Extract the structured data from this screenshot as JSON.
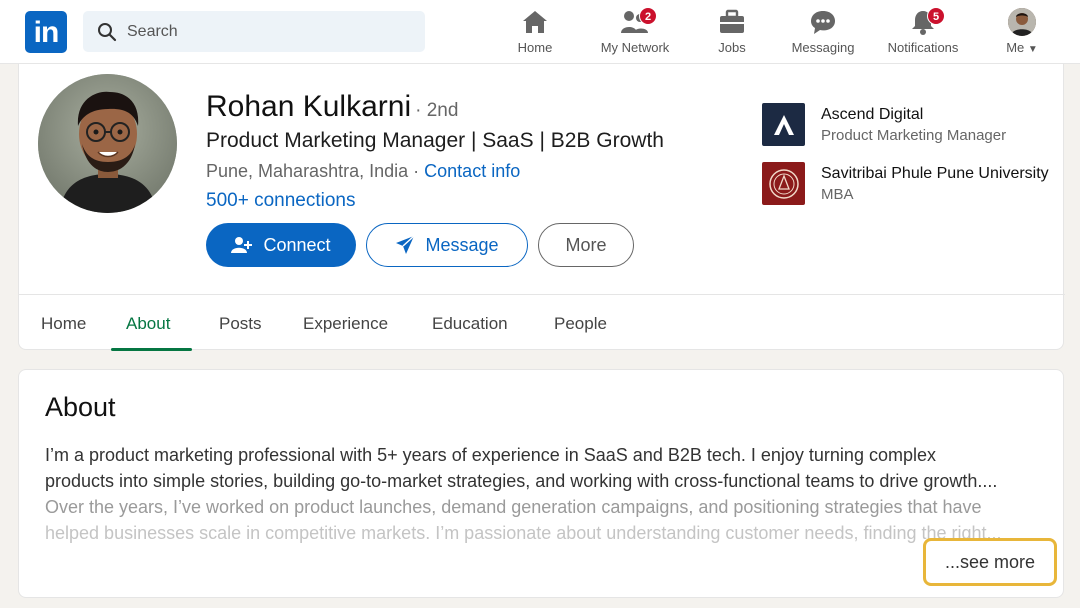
{
  "nav": {
    "logo_text": "in",
    "search_placeholder": "Search",
    "items": [
      {
        "label": "Home",
        "icon": "home-icon"
      },
      {
        "label": "My Network",
        "icon": "network-icon",
        "badge": "2"
      },
      {
        "label": "Jobs",
        "icon": "briefcase-icon"
      },
      {
        "label": "Messaging",
        "icon": "chat-icon"
      },
      {
        "label": "Notifications",
        "icon": "bell-icon",
        "badge": "5"
      },
      {
        "label": "Me",
        "icon": "avatar",
        "caret": "▼"
      }
    ]
  },
  "profile": {
    "name": "Rohan Kulkarni",
    "degree": "· 2nd",
    "headline": "Product Marketing Manager | SaaS | B2B Growth",
    "location": "Pune, Maharashtra, India",
    "separator": "·",
    "contact_info": "Contact info",
    "connections": "500+ connections",
    "buttons": {
      "connect": "Connect",
      "message": "Message",
      "more": "More"
    },
    "orgs": [
      {
        "name": "Ascend Digital",
        "sub": "Product Marketing Manager",
        "logo_color": "#1c2a43"
      },
      {
        "name": "Savitribai Phule Pune University",
        "sub": "MBA",
        "logo_color": "#8b1a1a"
      }
    ]
  },
  "tabs": [
    "Home",
    "About",
    "Posts",
    "Experience",
    "Education",
    "People"
  ],
  "active_tab": "About",
  "about": {
    "title": "About",
    "lines": [
      "I’m a product marketing professional with 5+ years of experience in SaaS and B2B tech. I enjoy turning complex",
      "products into simple stories, building go-to-market strategies, and working with cross-functional teams to drive growth....",
      "Over the years, I’ve worked on product launches, demand generation campaigns, and positioning strategies that have",
      "helped businesses scale in competitive markets. I’m passionate about understanding customer needs, finding the right..."
    ],
    "see_more": "...see more"
  },
  "colors": {
    "brand": "#0a66c2",
    "active_tab": "#057642",
    "highlight": "#e8b63a",
    "badge": "#cb112d"
  }
}
